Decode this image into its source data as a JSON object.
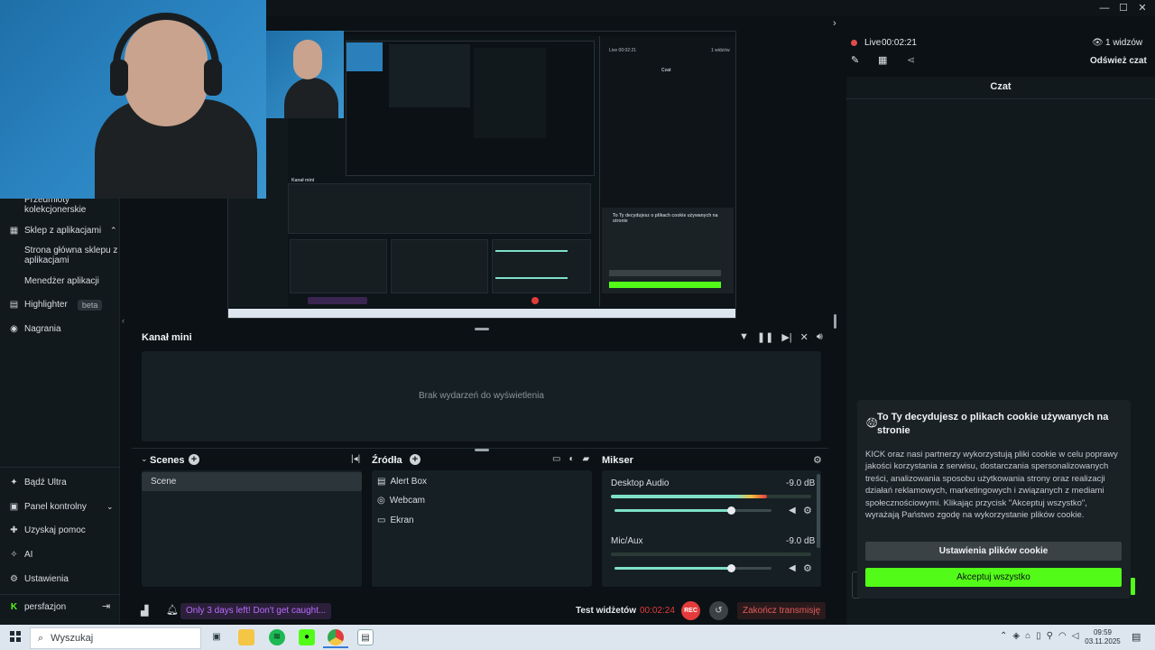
{
  "window": {
    "minimize": "—",
    "maximize": "☐",
    "close": "✕"
  },
  "sidebar": {
    "collectibles": "Przedmioty kolekcjonerskie",
    "app_store": "Sklep z aplikacjami",
    "app_store_home": "Strona główna sklepu z aplikacjami",
    "app_manager": "Menedżer aplikacji",
    "highlighter": "Highlighter",
    "highlighter_badge": "beta",
    "recordings": "Nagrania",
    "ultra": "Bądź Ultra",
    "dashboard": "Panel kontrolny",
    "help": "Uzyskaj pomoc",
    "ai": "AI",
    "settings": "Ustawienia",
    "user": "persfazjon"
  },
  "kanal_mini": {
    "title": "Kanał mini",
    "empty": "Brak wydarzeń do wyświetlenia"
  },
  "scenes": {
    "title": "Scenes",
    "items": [
      "Scene"
    ]
  },
  "sources": {
    "title": "Źródła",
    "items": [
      "Alert Box",
      "Webcam",
      "Ekran"
    ]
  },
  "mixer": {
    "title": "Mikser",
    "channels": [
      {
        "name": "Desktop Audio",
        "db": "-9.0 dB",
        "level": 0.78,
        "volume": 0.74
      },
      {
        "name": "Mic/Aux",
        "db": "-9.0 dB",
        "level": 0.0,
        "volume": 0.74
      }
    ]
  },
  "statusbar": {
    "promo": "Only 3 days left! Don't get caught...",
    "test_widgets": "Test widżetów",
    "timer": "00:02:24",
    "rec": "REC",
    "end_stream": "Zakończ transmisję"
  },
  "chat": {
    "live_label": "Live",
    "live_time": "00:02:21",
    "viewers": "1 widzów",
    "refresh": "Odśwież czat",
    "title": "Czat"
  },
  "cookie": {
    "title": "To Ty decydujesz o plikach cookie używanych na stronie",
    "body": "KICK oraz nasi partnerzy wykorzystują pliki cookie w celu poprawy jakości korzystania z serwisu, dostarczania spersonalizowanych treści, analizowania sposobu użytkowania strony oraz realizacji działań reklamowych, marketingowych i związanych z mediami społecznościowymi. Klikając przycisk \"Akceptuj wszystko\", wyrażają Państwo zgodę na wykorzystanie plików cookie.",
    "settings_btn": "Ustawienia plików cookie",
    "accept_btn": "Akceptuj wszystko"
  },
  "taskbar": {
    "search": "Wyszukaj",
    "time": "09:59",
    "date": "03.11.2025"
  },
  "colors": {
    "accent_green": "#53fc18",
    "rec_red": "#e33b3b",
    "live_red": "#e04b4b",
    "promo_purple": "#b86cff"
  }
}
